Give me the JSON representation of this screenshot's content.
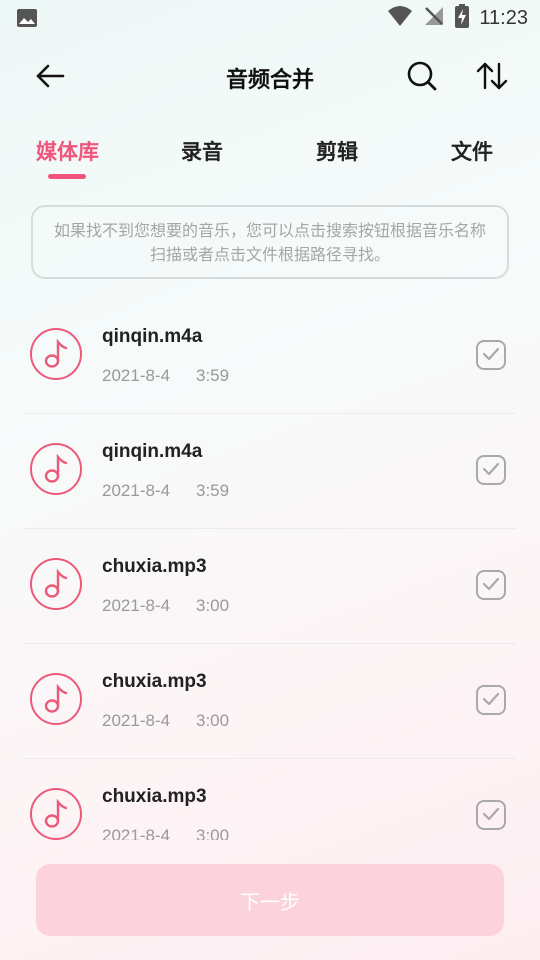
{
  "status_bar": {
    "time": "11:23",
    "icons": [
      "image-icon",
      "wifi-icon",
      "signal-off-icon",
      "battery-charging-icon"
    ]
  },
  "header": {
    "title": "音频合并",
    "icons": [
      "back-arrow-icon",
      "search-icon",
      "sort-icon"
    ]
  },
  "tabs": [
    {
      "label": "媒体库",
      "active": true
    },
    {
      "label": "录音",
      "active": false
    },
    {
      "label": "剪辑",
      "active": false
    },
    {
      "label": "文件",
      "active": false
    }
  ],
  "notice": "如果找不到您想要的音乐，您可以点击搜索按钮根据音乐名称扫描或者点击文件根据路径寻找。",
  "files": [
    {
      "name": "qinqin.m4a",
      "date": "2021-8-4",
      "duration": "3:59"
    },
    {
      "name": "qinqin.m4a",
      "date": "2021-8-4",
      "duration": "3:59"
    },
    {
      "name": "chuxia.mp3",
      "date": "2021-8-4",
      "duration": "3:00"
    },
    {
      "name": "chuxia.mp3",
      "date": "2021-8-4",
      "duration": "3:00"
    },
    {
      "name": "chuxia.mp3",
      "date": "2021-8-4",
      "duration": "3:00"
    }
  ],
  "next_button": "下一步",
  "colors": {
    "accent": "#f0557c",
    "button_disabled": "#fcd3dc"
  }
}
